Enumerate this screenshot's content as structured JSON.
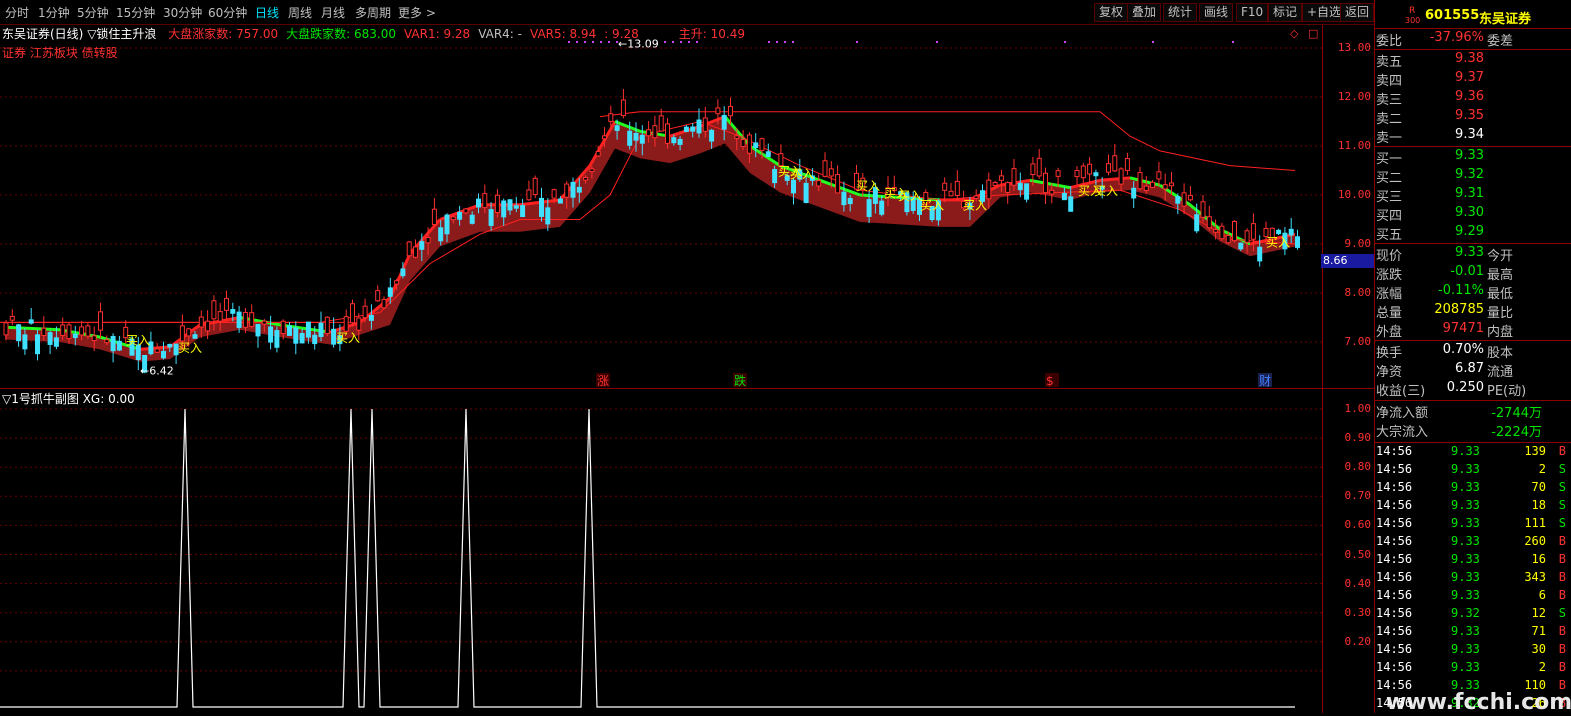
{
  "toolbar": {
    "tabs": [
      "分时",
      "1分钟",
      "5分钟",
      "15分钟",
      "30分钟",
      "60分钟",
      "日线",
      "周线",
      "月线",
      "多周期",
      "更多 >"
    ],
    "active_tab": "日线",
    "buttons": [
      "复权",
      "叠加",
      "统计",
      "画线",
      "F10",
      "标记",
      "+自选",
      "返回"
    ]
  },
  "main_chart": {
    "title": "东吴证券(日线)",
    "indicator": "▽锁住主升浪",
    "legend": [
      {
        "label": "大盘涨家数: 757.00",
        "color": "#ff3232"
      },
      {
        "label": "大盘跌家数: 683.00",
        "color": "#00e600"
      },
      {
        "label": "VAR1: 9.28",
        "color": "#ff3232"
      },
      {
        "label": "VAR4: -",
        "color": "#c0c0c0"
      },
      {
        "label": "VAR5: 8.94",
        "color": "#ff3232"
      },
      {
        "label": ": 9.28",
        "color": "#ff3232"
      },
      {
        "label": "主升: 10.49",
        "color": "#ff3232"
      }
    ],
    "tags": "证券 江苏板块 债转股",
    "high_label": "13.09",
    "low_label": "6.42",
    "price_ticks": [
      "13.00",
      "12.00",
      "11.00",
      "10.00",
      "9.00",
      "8.00",
      "7.00"
    ],
    "current_price_box": "8.66",
    "buy_label": "买入",
    "event_marks": [
      {
        "text": "涨",
        "color": "#ff3232"
      },
      {
        "text": "跌",
        "color": "#00e600"
      },
      {
        "text": "$",
        "color": "#ff3232"
      },
      {
        "text": "财",
        "color": "#4080ff"
      }
    ]
  },
  "sub_chart": {
    "title": "▽1号抓牛副图",
    "value": "XG: 0.00",
    "ticks": [
      "1.00",
      "0.90",
      "0.80",
      "0.70",
      "0.60",
      "0.50",
      "0.40",
      "0.30",
      "0.20"
    ]
  },
  "quote_panel": {
    "header": {
      "code": "601555",
      "name": "东吴证券",
      "badge_top": "R",
      "badge_bottom": "300"
    },
    "weibi": {
      "label": "委比",
      "value": "-37.96%",
      "label2": "委差"
    },
    "asks": [
      {
        "label": "卖五",
        "price": "9.38"
      },
      {
        "label": "卖四",
        "price": "9.37"
      },
      {
        "label": "卖三",
        "price": "9.36"
      },
      {
        "label": "卖二",
        "price": "9.35"
      },
      {
        "label": "卖一",
        "price": "9.34"
      }
    ],
    "bids": [
      {
        "label": "买一",
        "price": "9.33"
      },
      {
        "label": "买二",
        "price": "9.32"
      },
      {
        "label": "买三",
        "price": "9.31"
      },
      {
        "label": "买四",
        "price": "9.30"
      },
      {
        "label": "买五",
        "price": "9.29"
      }
    ],
    "stats": [
      {
        "label": "现价",
        "value": "9.33",
        "label2": "今开",
        "cls": "green"
      },
      {
        "label": "涨跌",
        "value": "-0.01",
        "label2": "最高",
        "cls": "green"
      },
      {
        "label": "涨幅",
        "value": "-0.11%",
        "label2": "最低",
        "cls": "green"
      },
      {
        "label": "总量",
        "value": "208785",
        "label2": "量比",
        "cls": "yellow"
      },
      {
        "label": "外盘",
        "value": "97471",
        "label2": "内盘",
        "cls": "red"
      }
    ],
    "fundamentals": [
      {
        "label": "换手",
        "value": "0.70%",
        "label2": "股本"
      },
      {
        "label": "净资",
        "value": "6.87",
        "label2": "流通"
      },
      {
        "label": "收益(三)",
        "value": "0.250",
        "label2": "PE(动)"
      }
    ],
    "flows": [
      {
        "label": "净流入额",
        "value": "-2744万"
      },
      {
        "label": "大宗流入",
        "value": "-2224万"
      }
    ],
    "trades": [
      {
        "time": "14:56",
        "price": "9.33",
        "vol": "139",
        "side": "B"
      },
      {
        "time": "14:56",
        "price": "9.33",
        "vol": "2",
        "side": "S"
      },
      {
        "time": "14:56",
        "price": "9.33",
        "vol": "70",
        "side": "S"
      },
      {
        "time": "14:56",
        "price": "9.33",
        "vol": "18",
        "side": "S"
      },
      {
        "time": "14:56",
        "price": "9.33",
        "vol": "111",
        "side": "S"
      },
      {
        "time": "14:56",
        "price": "9.33",
        "vol": "260",
        "side": "B"
      },
      {
        "time": "14:56",
        "price": "9.33",
        "vol": "16",
        "side": "B"
      },
      {
        "time": "14:56",
        "price": "9.33",
        "vol": "343",
        "side": "B"
      },
      {
        "time": "14:56",
        "price": "9.33",
        "vol": "6",
        "side": "B"
      },
      {
        "time": "14:56",
        "price": "9.32",
        "vol": "12",
        "side": "S"
      },
      {
        "time": "14:56",
        "price": "9.33",
        "vol": "71",
        "side": "B"
      },
      {
        "time": "14:56",
        "price": "9.33",
        "vol": "30",
        "side": "B"
      },
      {
        "time": "14:56",
        "price": "9.33",
        "vol": "2",
        "side": "B"
      },
      {
        "time": "14:56",
        "price": "9.33",
        "vol": "110",
        "side": "B"
      },
      {
        "time": "14:56",
        "price": "9.32",
        "vol": "26",
        "side": "B"
      }
    ]
  },
  "watermark": "www.fcchi.com"
}
